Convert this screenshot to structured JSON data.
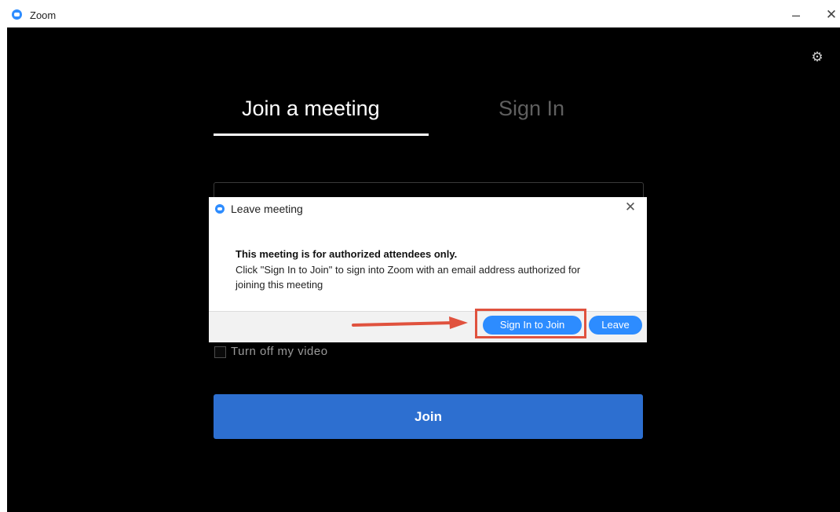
{
  "window": {
    "title": "Zoom",
    "minimize_glyph": "–",
    "close_glyph": "✕"
  },
  "settings_icon": "gear-icon",
  "tabs": [
    {
      "label": "Join a meeting",
      "active": true
    },
    {
      "label": "Sign In",
      "active": false
    }
  ],
  "video_option": {
    "label": "Turn off my video",
    "checked": false
  },
  "join_button": {
    "label": "Join",
    "color": "#2d6fd0"
  },
  "dialog": {
    "title": "Leave meeting",
    "heading": "This meeting is for authorized attendees only.",
    "body": "Click \"Sign In to Join\" to sign into Zoom with an email address authorized for joining this meeting",
    "sign_in_button": "Sign In to Join",
    "leave_button": "Leave",
    "close_glyph": "✕"
  },
  "colors": {
    "accent": "#2d8cff",
    "highlight": "#e0523e",
    "background": "#000000"
  }
}
